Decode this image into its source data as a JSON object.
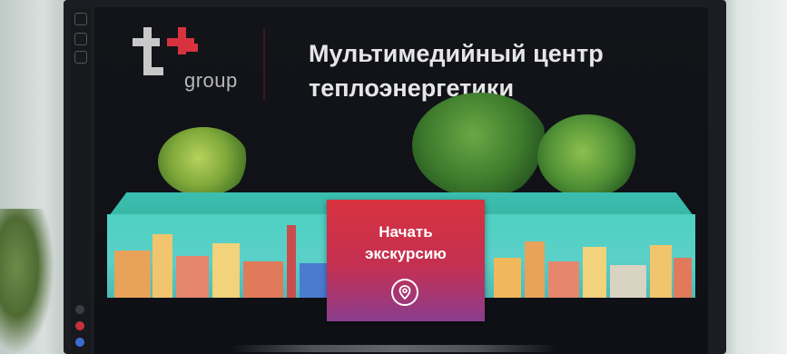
{
  "app": {
    "logo_text": "group",
    "title_line1": "Мультимедийный центр",
    "title_line2": "теплоэнергетики"
  },
  "start_button": {
    "label_line1": "Начать",
    "label_line2": "экскурсию",
    "icon": "location-pin-icon"
  },
  "colors": {
    "brand_red": "#d8323f",
    "button_gradient_end": "#8a3d8e",
    "platform_teal": "#3bbfb0",
    "screen_bg": "#121419",
    "title_text": "#e6e6e6"
  }
}
